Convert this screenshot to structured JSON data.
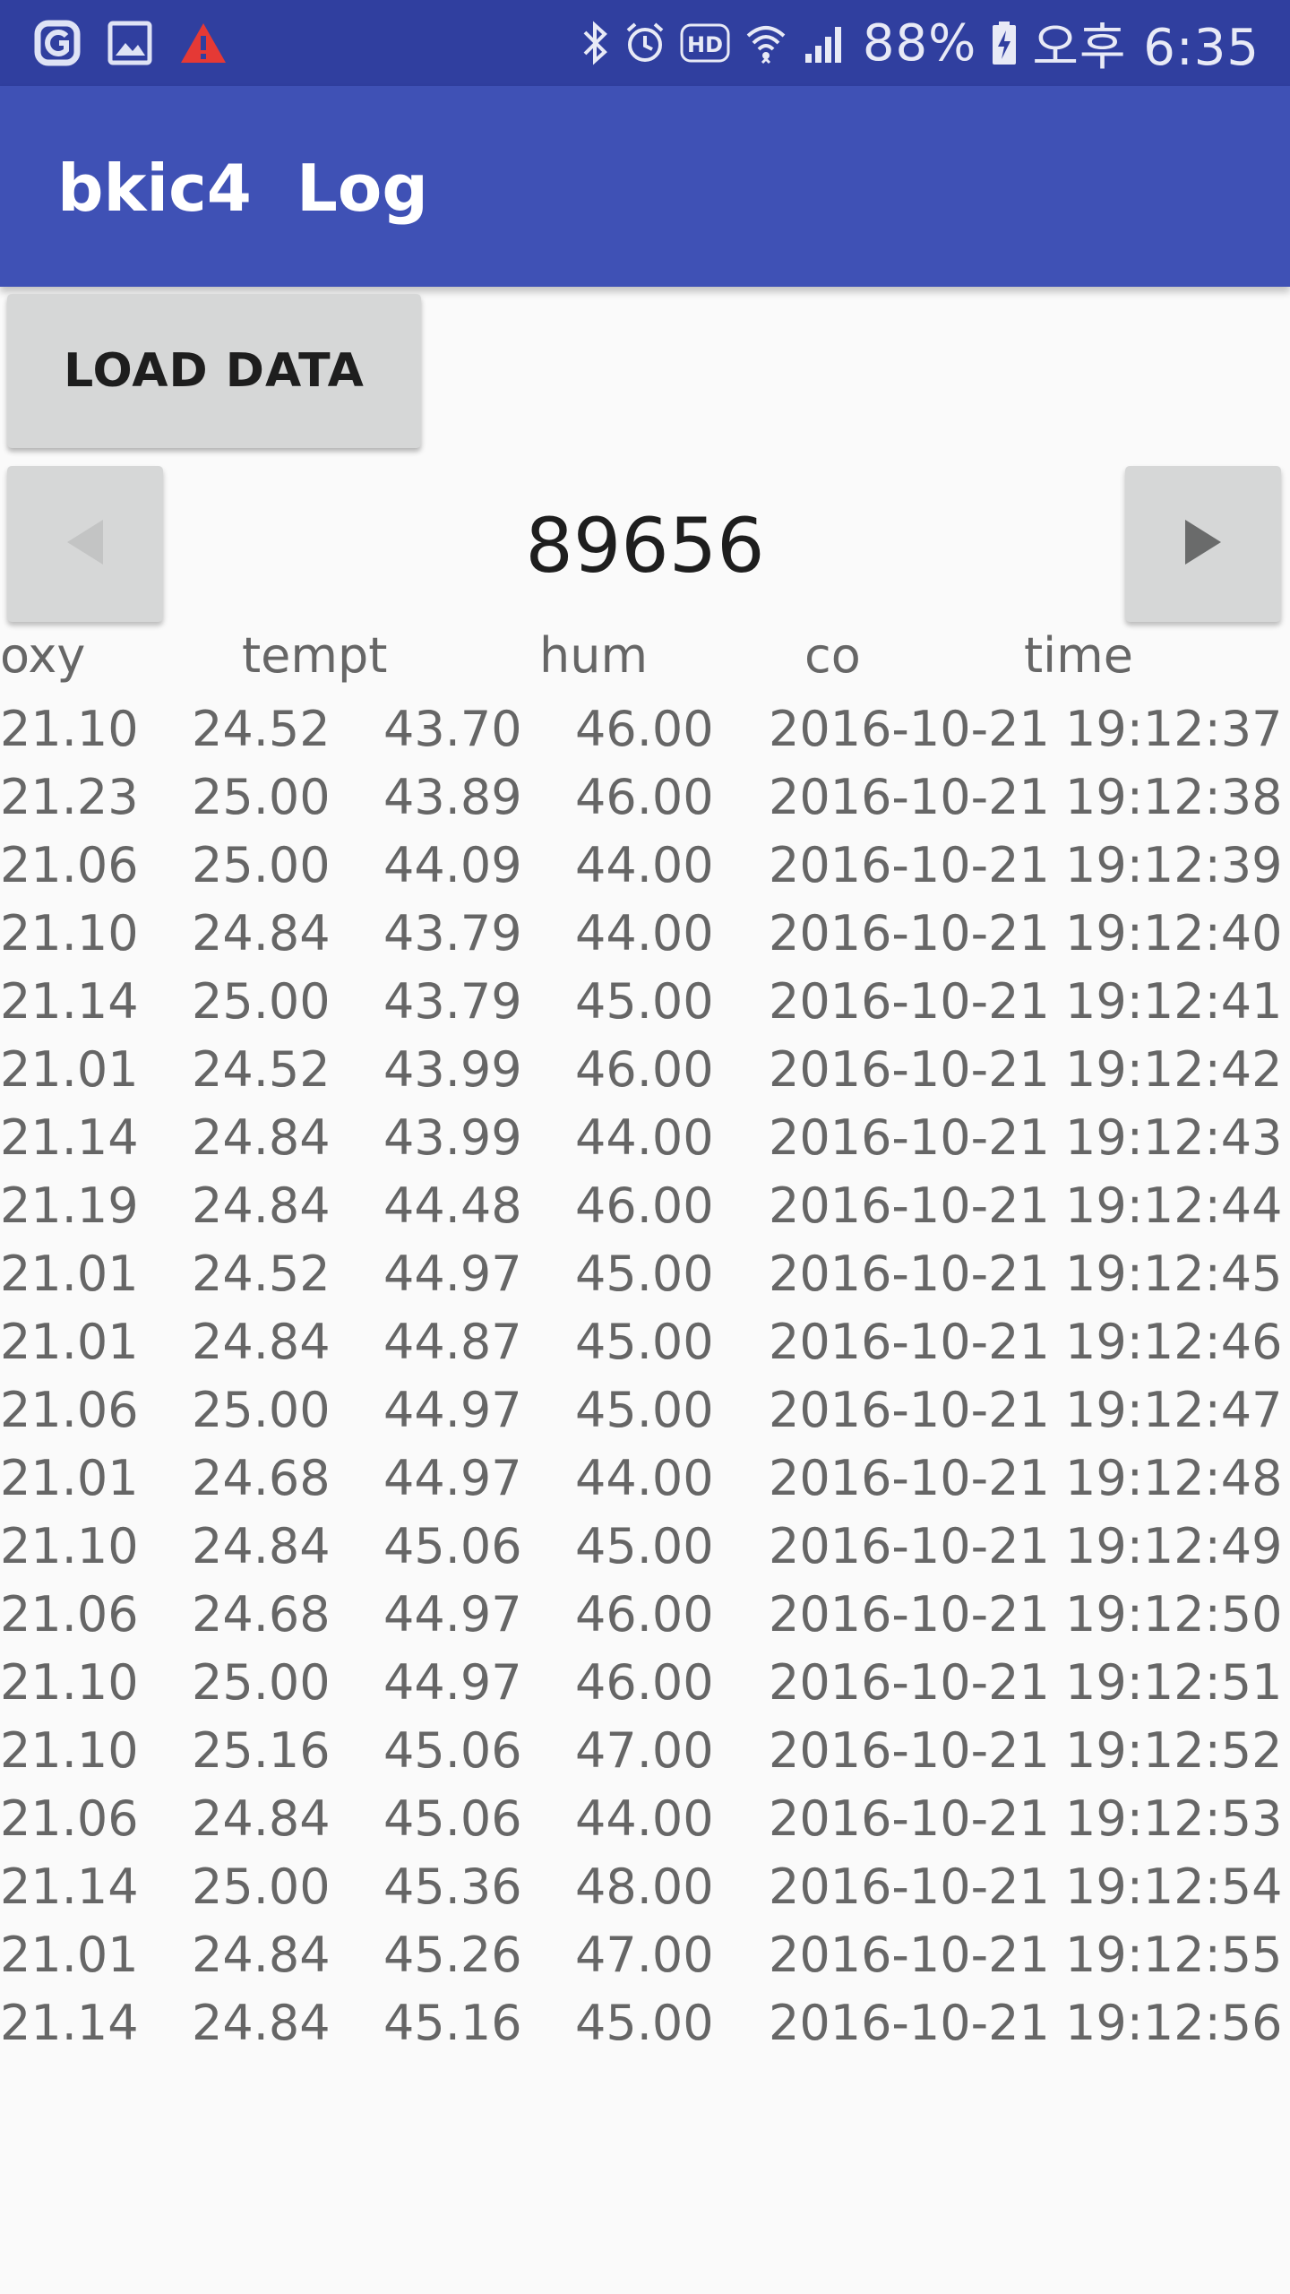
{
  "status_bar": {
    "battery": "88%",
    "time": "오후 6:35",
    "left_icons": [
      "app-notification-icon",
      "image-icon",
      "warning-icon"
    ],
    "right_icons": [
      "bluetooth-icon",
      "alarm-icon",
      "hd-icon",
      "wifi-icon",
      "signal-icon",
      "battery-charging-icon"
    ]
  },
  "app_bar": {
    "title": "bkic4  Log"
  },
  "load_button": {
    "label": "LOAD DATA"
  },
  "pager": {
    "page_number": "89656",
    "prev_icon": "arrow-left-icon",
    "next_icon": "arrow-right-icon"
  },
  "table": {
    "headers": [
      "oxy",
      "tempt",
      "hum",
      "co",
      "time"
    ],
    "rows": [
      [
        "21.10",
        "24.52",
        "43.70",
        "46.00",
        "2016-10-21 19:12:37"
      ],
      [
        "21.23",
        "25.00",
        "43.89",
        "46.00",
        "2016-10-21 19:12:38"
      ],
      [
        "21.06",
        "25.00",
        "44.09",
        "44.00",
        "2016-10-21 19:12:39"
      ],
      [
        "21.10",
        "24.84",
        "43.79",
        "44.00",
        "2016-10-21 19:12:40"
      ],
      [
        "21.14",
        "25.00",
        "43.79",
        "45.00",
        "2016-10-21 19:12:41"
      ],
      [
        "21.01",
        "24.52",
        "43.99",
        "46.00",
        "2016-10-21 19:12:42"
      ],
      [
        "21.14",
        "24.84",
        "43.99",
        "44.00",
        "2016-10-21 19:12:43"
      ],
      [
        "21.19",
        "24.84",
        "44.48",
        "46.00",
        "2016-10-21 19:12:44"
      ],
      [
        "21.01",
        "24.52",
        "44.97",
        "45.00",
        "2016-10-21 19:12:45"
      ],
      [
        "21.01",
        "24.84",
        "44.87",
        "45.00",
        "2016-10-21 19:12:46"
      ],
      [
        "21.06",
        "25.00",
        "44.97",
        "45.00",
        "2016-10-21 19:12:47"
      ],
      [
        "21.01",
        "24.68",
        "44.97",
        "44.00",
        "2016-10-21 19:12:48"
      ],
      [
        "21.10",
        "24.84",
        "45.06",
        "45.00",
        "2016-10-21 19:12:49"
      ],
      [
        "21.06",
        "24.68",
        "44.97",
        "46.00",
        "2016-10-21 19:12:50"
      ],
      [
        "21.10",
        "25.00",
        "44.97",
        "46.00",
        "2016-10-21 19:12:51"
      ],
      [
        "21.10",
        "25.16",
        "45.06",
        "47.00",
        "2016-10-21 19:12:52"
      ],
      [
        "21.06",
        "24.84",
        "45.06",
        "44.00",
        "2016-10-21 19:12:53"
      ],
      [
        "21.14",
        "25.00",
        "45.36",
        "48.00",
        "2016-10-21 19:12:54"
      ],
      [
        "21.01",
        "24.84",
        "45.26",
        "47.00",
        "2016-10-21 19:12:55"
      ],
      [
        "21.14",
        "24.84",
        "45.16",
        "45.00",
        "2016-10-21 19:12:56"
      ]
    ]
  },
  "colors": {
    "status_bar": "#303f9f",
    "app_bar": "#3f51b5",
    "button": "#d6d7d7",
    "background": "#fafafa",
    "table_text": "#666666"
  }
}
